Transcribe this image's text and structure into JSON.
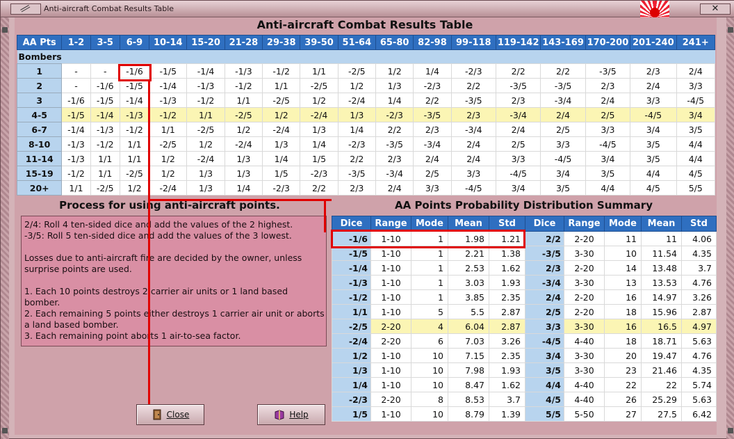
{
  "window": {
    "title": "Anti-aircraft Combat Results Table",
    "close_glyph": "✕"
  },
  "main_title": "Anti-aircraft Combat Results Table",
  "crt": {
    "corner": "AA Pts",
    "columns": [
      "1-2",
      "3-5",
      "6-9",
      "10-14",
      "15-20",
      "21-28",
      "29-38",
      "39-50",
      "51-64",
      "65-80",
      "82-98",
      "99-118",
      "119-142",
      "143-169",
      "170-200",
      "201-240",
      "241+"
    ],
    "section_label": "Bombers",
    "rows": [
      {
        "label": "1",
        "cells": [
          "-",
          "-",
          "-1/6",
          "-1/5",
          "-1/4",
          "-1/3",
          "-1/2",
          "1/1",
          "-2/5",
          "1/2",
          "1/4",
          "-2/3",
          "2/2",
          "2/2",
          "-3/5",
          "2/3",
          "2/4"
        ]
      },
      {
        "label": "2",
        "cells": [
          "-",
          "-1/6",
          "-1/5",
          "-1/4",
          "-1/3",
          "-1/2",
          "1/1",
          "-2/5",
          "1/2",
          "1/3",
          "-2/3",
          "2/2",
          "-3/5",
          "-3/5",
          "2/3",
          "2/4",
          "3/3"
        ]
      },
      {
        "label": "3",
        "cells": [
          "-1/6",
          "-1/5",
          "-1/4",
          "-1/3",
          "-1/2",
          "1/1",
          "-2/5",
          "1/2",
          "-2/4",
          "1/4",
          "2/2",
          "-3/5",
          "2/3",
          "-3/4",
          "2/4",
          "3/3",
          "-4/5"
        ]
      },
      {
        "label": "4-5",
        "cells": [
          "-1/5",
          "-1/4",
          "-1/3",
          "-1/2",
          "1/1",
          "-2/5",
          "1/2",
          "-2/4",
          "1/3",
          "-2/3",
          "-3/5",
          "2/3",
          "-3/4",
          "2/4",
          "2/5",
          "-4/5",
          "3/4"
        ]
      },
      {
        "label": "6-7",
        "cells": [
          "-1/4",
          "-1/3",
          "-1/2",
          "1/1",
          "-2/5",
          "1/2",
          "-2/4",
          "1/3",
          "1/4",
          "2/2",
          "2/3",
          "-3/4",
          "2/4",
          "2/5",
          "3/3",
          "3/4",
          "3/5"
        ]
      },
      {
        "label": "8-10",
        "cells": [
          "-1/3",
          "-1/2",
          "1/1",
          "-2/5",
          "1/2",
          "-2/4",
          "1/3",
          "1/4",
          "-2/3",
          "-3/5",
          "-3/4",
          "2/4",
          "2/5",
          "3/3",
          "-4/5",
          "3/5",
          "4/4"
        ]
      },
      {
        "label": "11-14",
        "cells": [
          "-1/3",
          "1/1",
          "1/1",
          "1/2",
          "-2/4",
          "1/3",
          "1/4",
          "1/5",
          "2/2",
          "2/3",
          "2/4",
          "2/4",
          "3/3",
          "-4/5",
          "3/4",
          "3/5",
          "4/4"
        ]
      },
      {
        "label": "15-19",
        "cells": [
          "-1/2",
          "1/1",
          "-2/5",
          "1/2",
          "1/3",
          "1/3",
          "1/5",
          "-2/3",
          "-3/5",
          "-3/4",
          "2/5",
          "3/3",
          "-4/5",
          "3/4",
          "3/5",
          "4/4",
          "4/5"
        ]
      },
      {
        "label": "20+",
        "cells": [
          "1/1",
          "-2/5",
          "1/2",
          "-2/4",
          "1/3",
          "1/4",
          "-2/3",
          "2/2",
          "2/3",
          "2/4",
          "3/3",
          "-4/5",
          "3/4",
          "3/5",
          "4/4",
          "4/5",
          "5/5"
        ]
      }
    ]
  },
  "process": {
    "title": "Process for using anti-aircraft points.",
    "line1": "2/4: Roll 4 ten-sided dice and add the values of the 2 highest.",
    "line2": "-3/5: Roll 5 ten-sided dice and add the values of the 3 lowest.",
    "line3": "Losses due to anti-aircraft fire are decided by the owner, unless surprise points are used.",
    "line4": "1.  Each 10 points destroys 2 carrier air units or 1 land based bomber.",
    "line5": "2.  Each remaining 5 points either destroys 1 carrier air unit or aborts a land based bomber.",
    "line6": "3.  Each remaining point aborts 1 air-to-sea factor."
  },
  "summary": {
    "title": "AA Points Probability Distribution Summary",
    "headers": [
      "Dice",
      "Range",
      "Mode",
      "Mean",
      "Std",
      "Dice",
      "Range",
      "Mode",
      "Mean",
      "Std"
    ],
    "rows": [
      [
        "-1/6",
        "1-10",
        "1",
        "1.98",
        "1.21",
        "2/2",
        "2-20",
        "11",
        "11",
        "4.06"
      ],
      [
        "-1/5",
        "1-10",
        "1",
        "2.21",
        "1.38",
        "-3/5",
        "3-30",
        "10",
        "11.54",
        "4.35"
      ],
      [
        "-1/4",
        "1-10",
        "1",
        "2.53",
        "1.62",
        "2/3",
        "2-20",
        "14",
        "13.48",
        "3.7"
      ],
      [
        "-1/3",
        "1-10",
        "1",
        "3.03",
        "1.93",
        "-3/4",
        "3-30",
        "13",
        "13.53",
        "4.76"
      ],
      [
        "-1/2",
        "1-10",
        "1",
        "3.85",
        "2.35",
        "2/4",
        "2-20",
        "16",
        "14.97",
        "3.26"
      ],
      [
        "1/1",
        "1-10",
        "5",
        "5.5",
        "2.87",
        "2/5",
        "2-20",
        "18",
        "15.96",
        "2.87"
      ],
      [
        "-2/5",
        "2-20",
        "4",
        "6.04",
        "2.87",
        "3/3",
        "3-30",
        "16",
        "16.5",
        "4.97"
      ],
      [
        "-2/4",
        "2-20",
        "6",
        "7.03",
        "3.26",
        "-4/5",
        "4-40",
        "18",
        "18.71",
        "5.63"
      ],
      [
        "1/2",
        "1-10",
        "10",
        "7.15",
        "2.35",
        "3/4",
        "3-30",
        "20",
        "19.47",
        "4.76"
      ],
      [
        "1/3",
        "1-10",
        "10",
        "7.98",
        "1.93",
        "3/5",
        "3-30",
        "23",
        "21.46",
        "4.35"
      ],
      [
        "1/4",
        "1-10",
        "10",
        "8.47",
        "1.62",
        "4/4",
        "4-40",
        "22",
        "22",
        "5.74"
      ],
      [
        "-2/3",
        "2-20",
        "8",
        "8.53",
        "3.7",
        "4/5",
        "4-40",
        "26",
        "25.29",
        "5.63"
      ],
      [
        "1/5",
        "1-10",
        "10",
        "8.79",
        "1.39",
        "5/5",
        "5-50",
        "27",
        "27.5",
        "6.42"
      ]
    ]
  },
  "buttons": {
    "close_label": "Close",
    "help_label": "Help"
  },
  "colors": {
    "header_blue": "#2f6fc0",
    "row_head_blue": "#b8d4ee",
    "highlight_yellow": "#fbf5b4",
    "annotation_red": "#e00000",
    "process_box_pink": "#d98fa4"
  }
}
